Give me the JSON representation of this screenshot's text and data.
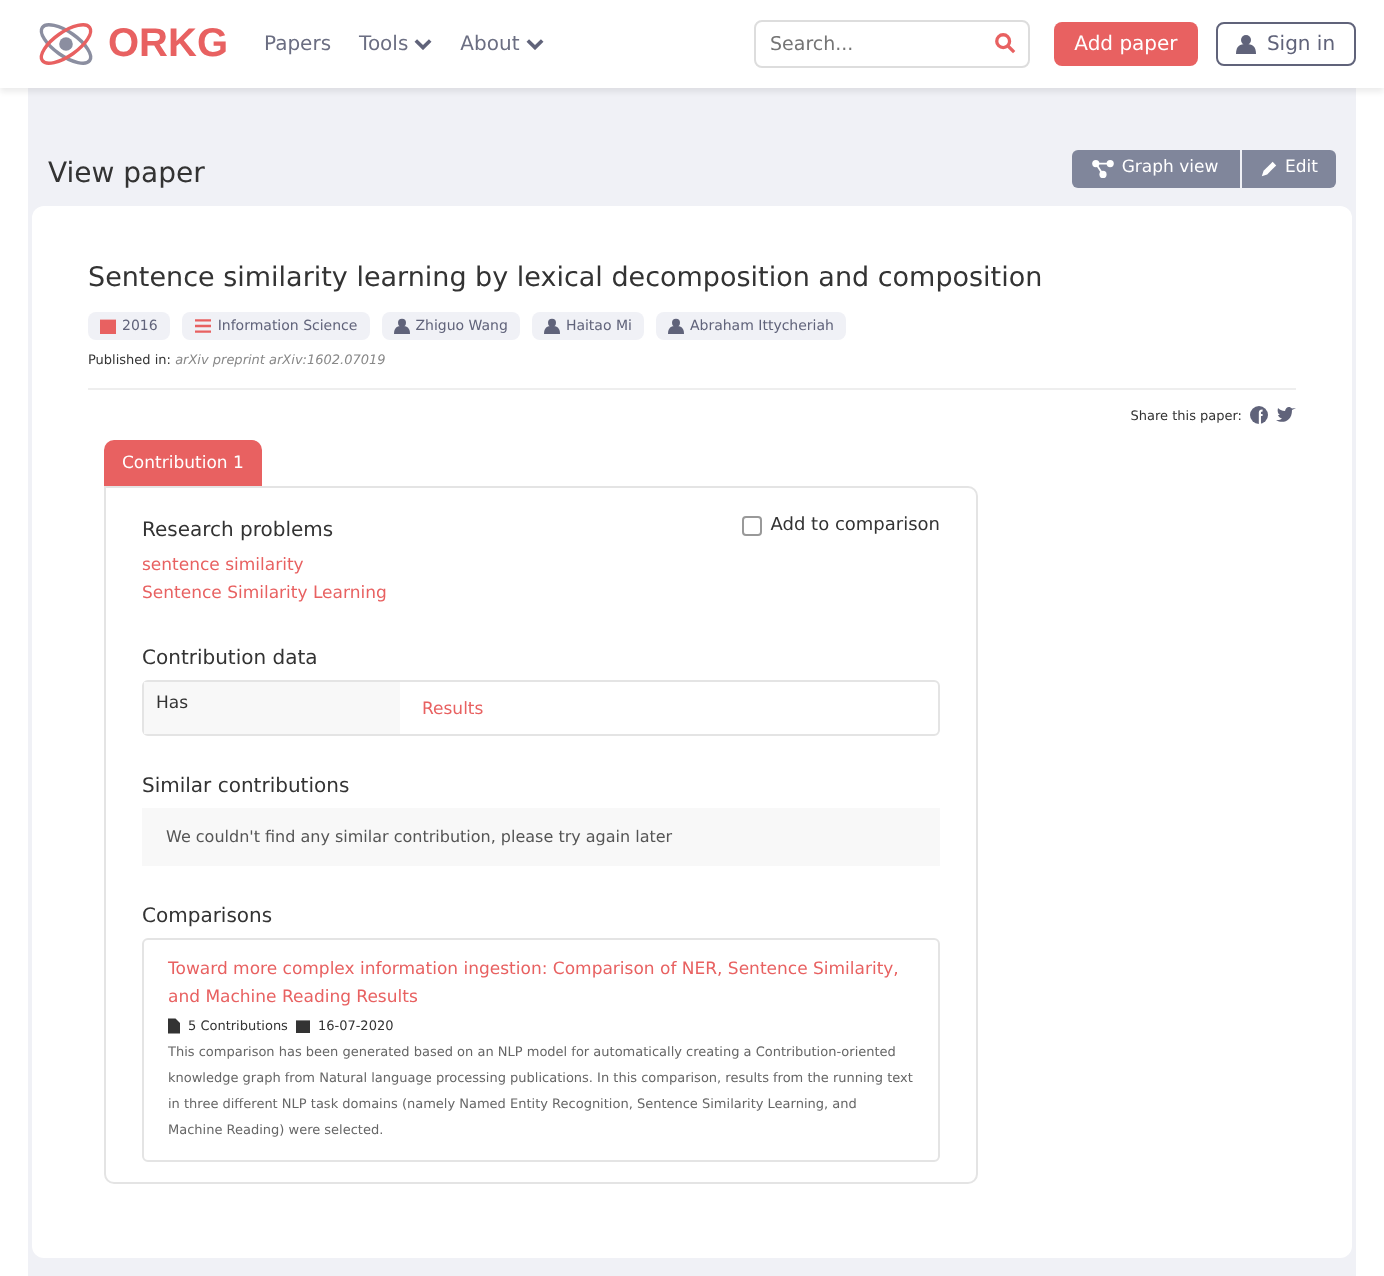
{
  "navbar": {
    "logo": "ORKG",
    "links": [
      {
        "label": "Papers",
        "dropdown": false
      },
      {
        "label": "Tools",
        "dropdown": true
      },
      {
        "label": "About",
        "dropdown": true
      }
    ],
    "search": {
      "placeholder": "Search..."
    },
    "add_button": "Add paper",
    "sign_in": "Sign in"
  },
  "page_title": "View paper",
  "actions": [
    "Graph view",
    "Edit"
  ],
  "paper": {
    "title": "Sentence similarity learning by lexical decomposition and composition",
    "badges": [
      {
        "kind": "year",
        "label": "2016"
      },
      {
        "kind": "field",
        "label": "Information Science"
      },
      {
        "kind": "author",
        "label": "Zhiguo Wang"
      },
      {
        "kind": "author",
        "label": "Haitao Mi"
      },
      {
        "kind": "author",
        "label": "Abraham Ittycheriah"
      }
    ],
    "published_label": "Published in:",
    "published_in": "arXiv preprint arXiv:1602.07019",
    "share_label": "Share this paper:"
  },
  "tabs": [
    {
      "label": "Contribution 1",
      "selected": true
    }
  ],
  "contribution": {
    "research_problems_heading": "Research problems",
    "add_to_comparison": {
      "label": "Add to comparison",
      "checked": false
    },
    "research_problems": [
      "sentence similarity",
      "Sentence Similarity Learning"
    ],
    "data_heading": "Contribution data",
    "data_rows": [
      {
        "property": "Has",
        "value": "Results"
      }
    ],
    "similar_heading": "Similar contributions",
    "similar_empty": "We couldn't find any similar contribution, please try again later",
    "comparisons_heading": "Comparisons",
    "comparisons": [
      {
        "title": "Toward more complex information ingestion: Comparison of NER, Sentence Similarity, and Machine Reading Results",
        "contributions": "5 Contributions",
        "date": "16-07-2020",
        "description": "This comparison has been generated based on an NLP model for automatically creating a Contribution-oriented knowledge graph from Natural language processing publications. In this comparison, results from the running text in three different NLP task domains (namely Named Entity Recognition, Sentence Similarity Learning, and Machine Reading) were selected."
      }
    ]
  }
}
